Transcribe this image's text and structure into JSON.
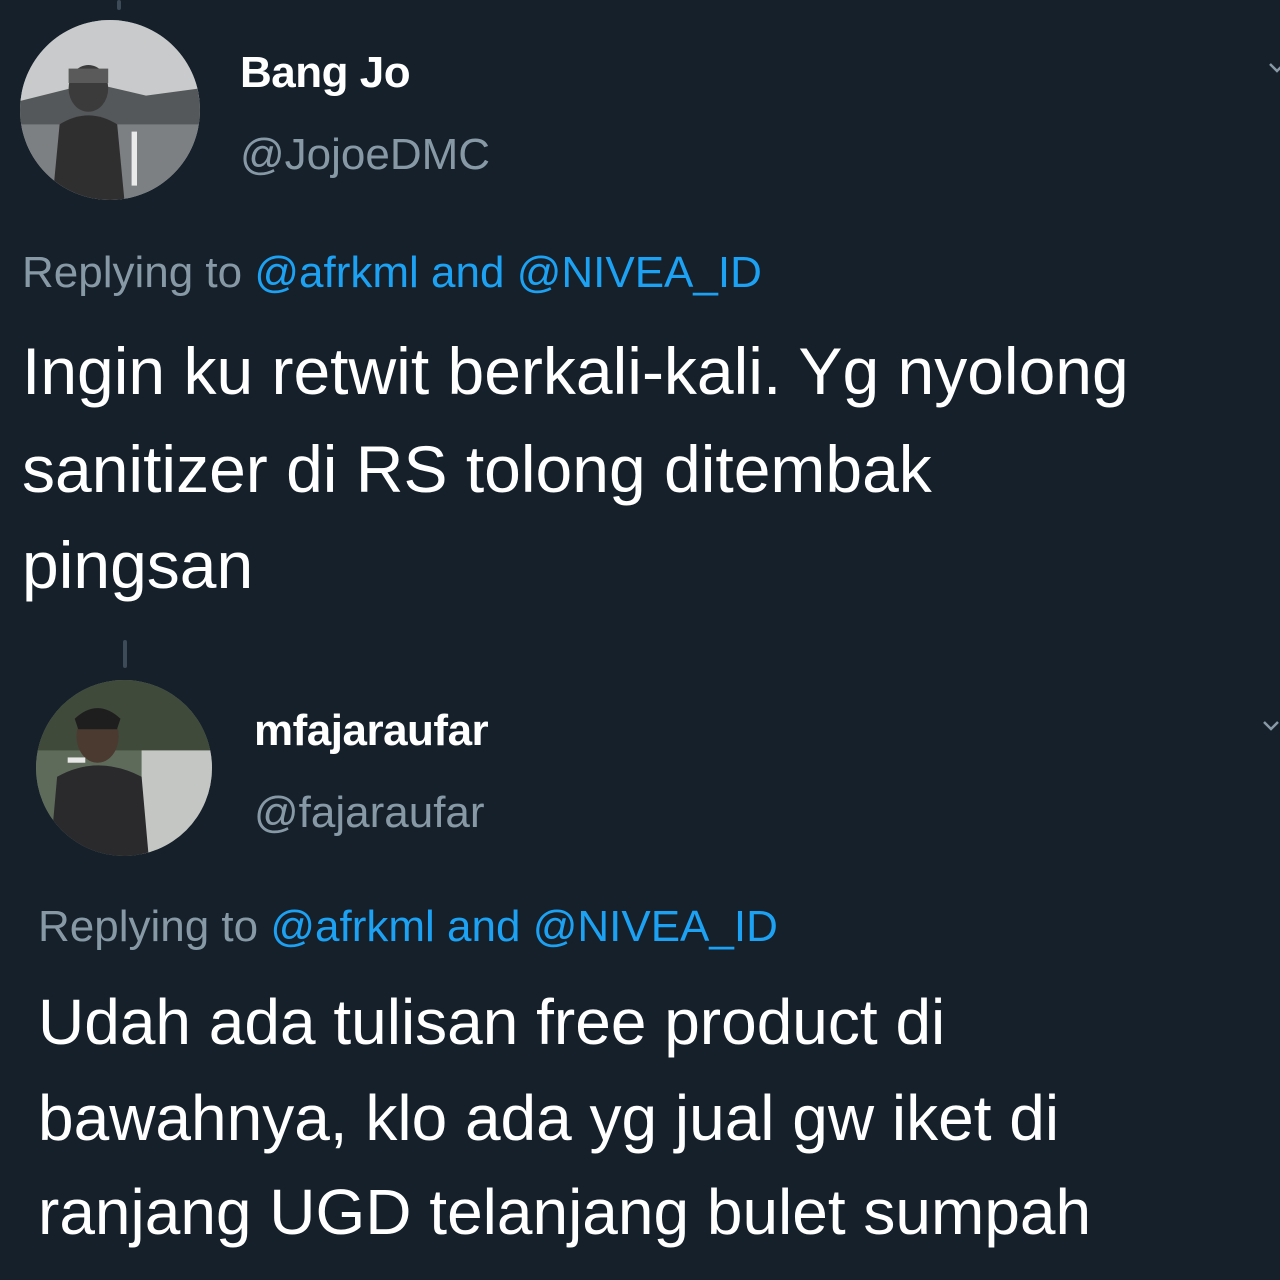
{
  "tweets": [
    {
      "name": "Bang Jo",
      "handle": "@JojoeDMC",
      "reply_prefix": "Replying to ",
      "mention_1": "@afrkml",
      "reply_and": " and ",
      "mention_2": "@NIVEA_ID",
      "lines": [
        "Ingin ku retwit berkali-kali. Yg nyolong",
        "sanitizer di RS tolong ditembak",
        "pingsan"
      ],
      "avatar_icon": "user-photo-icon"
    },
    {
      "name": "mfajaraufar",
      "handle": "@fajaraufar",
      "reply_prefix": "Replying to ",
      "mention_1": "@afrkml",
      "reply_and": " and ",
      "mention_2": "@NIVEA_ID",
      "lines": [
        "Udah ada tulisan free product di",
        "bawahnya, klo ada yg jual gw iket di",
        "ranjang UGD telanjang bulet sumpah"
      ],
      "avatar_icon": "user-photo-icon"
    }
  ],
  "colors": {
    "background": "#15202b",
    "text": "#ffffff",
    "secondary": "#8899a6",
    "link": "#1da1f2"
  }
}
